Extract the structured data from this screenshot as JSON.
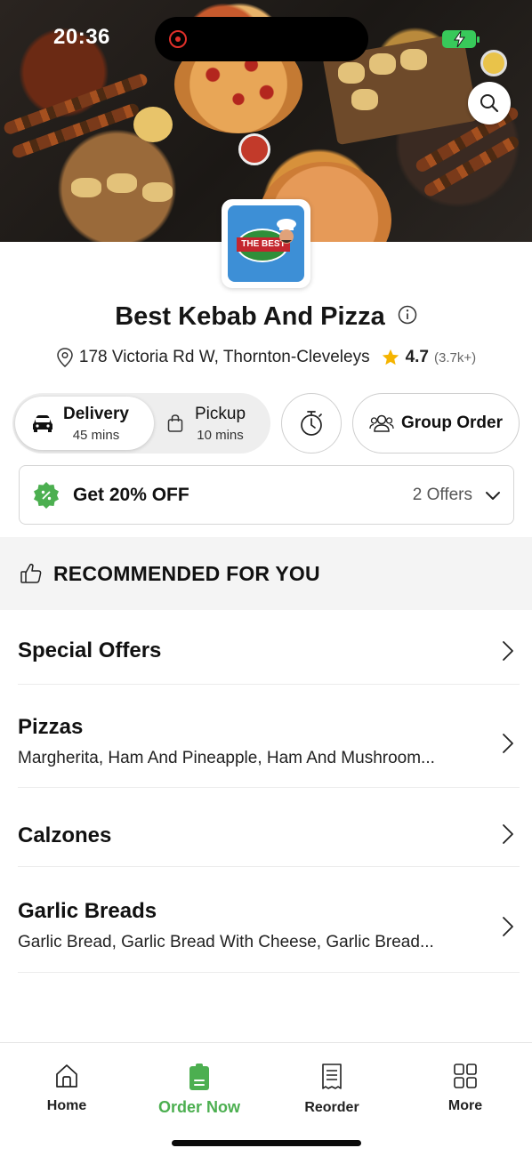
{
  "status_bar": {
    "time": "20:36"
  },
  "store": {
    "name": "Best Kebab And Pizza",
    "address": "178 Victoria Rd W, Thornton-Cleveleys",
    "rating": "4.7",
    "rating_count": "(3.7k+)",
    "logo_text": "THE BEST"
  },
  "fulfilment": {
    "delivery_label": "Delivery",
    "delivery_time": "45 mins",
    "pickup_label": "Pickup",
    "pickup_time": "10 mins",
    "group_order_label": "Group Order"
  },
  "offer": {
    "title": "Get 20% OFF",
    "count": "2 Offers"
  },
  "recommended": {
    "title": "RECOMMENDED FOR YOU"
  },
  "categories": [
    {
      "title": "Special Offers",
      "desc": ""
    },
    {
      "title": "Pizzas",
      "desc": "Margherita, Ham And Pineapple, Ham And Mushroom..."
    },
    {
      "title": "Calzones",
      "desc": ""
    },
    {
      "title": "Garlic Breads",
      "desc": "Garlic Bread, Garlic Bread With Cheese, Garlic Bread..."
    }
  ],
  "bottom_nav": [
    {
      "label": "Home",
      "icon": "home-icon"
    },
    {
      "label": "Order Now",
      "icon": "order-icon",
      "active": true
    },
    {
      "label": "Reorder",
      "icon": "receipt-icon"
    },
    {
      "label": "More",
      "icon": "grid-icon"
    }
  ],
  "colors": {
    "accent": "#4caf50",
    "star": "#f5b400",
    "offer_badge": "#4caf50",
    "logo_bg": "#3d8fd6"
  }
}
